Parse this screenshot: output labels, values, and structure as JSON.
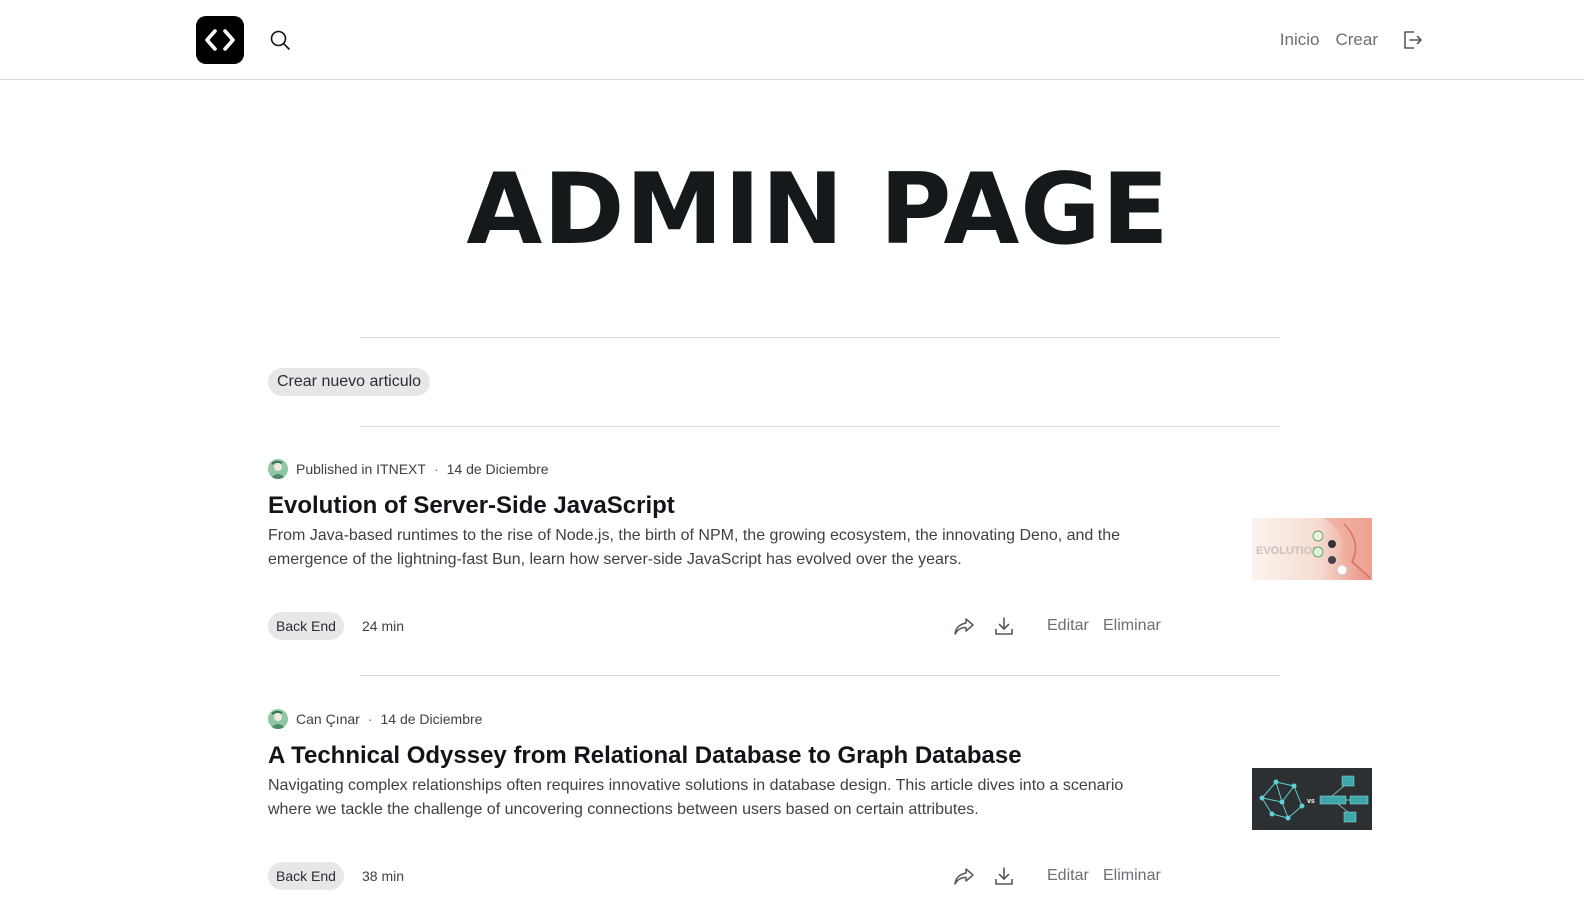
{
  "header": {
    "logo_icon": "code-brackets-icon",
    "search_icon": "search-icon",
    "nav": {
      "home_label": "Inicio",
      "create_label": "Crear",
      "logout_icon": "logout-icon"
    }
  },
  "page": {
    "title": "ADMIN PAGE",
    "create_button_label": "Crear nuevo articulo"
  },
  "articles": [
    {
      "byline": "Published in ITNEXT",
      "date": "14 de Diciembre",
      "title": "Evolution of Server-Side JavaScript",
      "description": "From Java-based runtimes to the rise of Node.js, the birth of NPM, the growing ecosystem, the innovating Deno, and the emergence of the lightning-fast Bun, learn how server-side JavaScript has evolved over the years.",
      "tag": "Back End",
      "read_time": "24 min",
      "thumb_text": "EVOLUTION",
      "edit_label": "Editar",
      "delete_label": "Eliminar"
    },
    {
      "byline": "Can Çınar",
      "date": "14 de Diciembre",
      "title": "A Technical Odyssey from Relational Database to Graph Database",
      "description": "Navigating complex relationships often requires innovative solutions in database design. This article dives into a scenario where we tackle the challenge of uncovering connections between users based on certain attributes.",
      "tag": "Back End",
      "read_time": "38 min",
      "thumb_text": "vs",
      "edit_label": "Editar",
      "delete_label": "Eliminar"
    }
  ],
  "colors": {
    "accent_dark": "#000000",
    "muted_text": "#6b6f75",
    "chip_bg": "#e6e7e9",
    "divider": "#d7d9dc"
  }
}
